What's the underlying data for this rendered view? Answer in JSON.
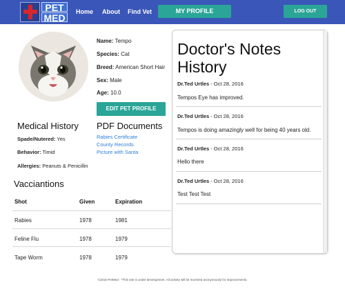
{
  "nav": {
    "logo_top": "PET",
    "logo_bottom": "MED",
    "links": [
      "Home",
      "About",
      "Find Vet"
    ],
    "my_profile": "MY PROFILE",
    "logout": "LOG OUT"
  },
  "pet": {
    "name_label": "Name:",
    "name": "Tempo",
    "species_label": "Species:",
    "species": "Cat",
    "breed_label": "Breed:",
    "breed": "American Short Hair",
    "sex_label": "Sex:",
    "sex": "Male",
    "age_label": "Age:",
    "age": "10.0",
    "edit_button": "EDIT PET PROFILE"
  },
  "medical_history": {
    "title": "Medical History",
    "spade_label": "Spade/Nutered:",
    "spade": "Yes",
    "behavior_label": "Behavior:",
    "behavior": "Timid",
    "allergies_label": "Allergies:",
    "allergies": "Peanuts & Penicillin"
  },
  "pdf_documents": {
    "title": "PDF Documents",
    "links": [
      "Rabies Certificate",
      "County Records",
      "Picture with Santa"
    ]
  },
  "vaccinations": {
    "title": "Vacciantions",
    "headers": [
      "Shot",
      "Given",
      "Expiration"
    ],
    "rows": [
      [
        "Rabies",
        "1978",
        "1981"
      ],
      [
        "Feline Flu",
        "1978",
        "1979"
      ],
      [
        "Tape Worm",
        "1978",
        "1979"
      ]
    ]
  },
  "notes": {
    "title_line1": "Doctor's Notes",
    "title_line2": "History",
    "items": [
      {
        "doctor": "Dr.Ted Urtles",
        "date": " - Oct 28, 2016",
        "text": "Tempos Eye has improved."
      },
      {
        "doctor": "Dr.Ted Urtles",
        "date": " - Oct 28, 2016",
        "text": "Tempos is doing amazingly well for being 40 years old."
      },
      {
        "doctor": "Dr.Ted Urtles",
        "date": " - Oct 28, 2016",
        "text": "Hello there"
      },
      {
        "doctor": "Dr.Ted Urtles",
        "date": " - Oct 28, 2016",
        "text": "Test Test Test"
      }
    ]
  },
  "footer": "©2016 PetMed - *This site is under development. All activity will be monitred anonymously for improvements."
}
